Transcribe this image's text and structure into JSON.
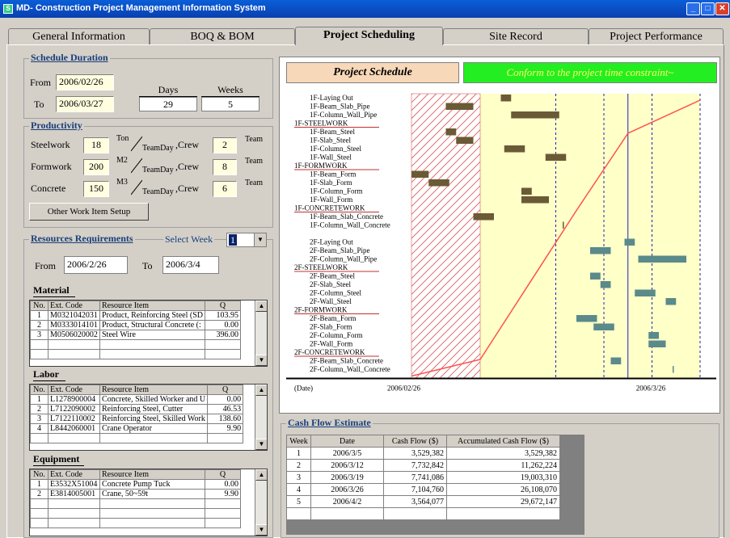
{
  "window": {
    "title": "MD- Construction Project Management Information System"
  },
  "tabs": [
    "General Information",
    "BOQ & BOM",
    "Project Scheduling",
    "Site Record",
    "Project Performance"
  ],
  "schedule_duration": {
    "title": "Schedule Duration",
    "from_label": "From",
    "from_value": "2006/02/26",
    "to_label": "To",
    "to_value": "2006/03/27",
    "days_label": "Days",
    "days_value": "29",
    "weeks_label": "Weeks",
    "weeks_value": "5"
  },
  "productivity": {
    "title": "Productivity",
    "rows": [
      {
        "name": "Steelwork",
        "value": "18",
        "unit": "Ton",
        "crew": "2"
      },
      {
        "name": "Formwork",
        "value": "200",
        "unit": "M2",
        "crew": "8"
      },
      {
        "name": "Concrete",
        "value": "150",
        "unit": "M3",
        "crew": "6"
      }
    ],
    "per_label": "TeamDay",
    "crew_label": ",Crew",
    "team_label": "Team",
    "other_button": "Other Work Item Setup"
  },
  "resources": {
    "title": "Resources Requirements",
    "select_week_label": "Select Week",
    "week_value": "1",
    "from_label": "From",
    "from_value": "2006/2/26",
    "to_label": "To",
    "to_value": "2006/3/4",
    "headers": [
      "No.",
      "Ext. Code",
      "Resource Item",
      "Q"
    ],
    "material_title": "Material",
    "material": [
      [
        "1",
        "M0321042031",
        "Product, Reinforcing Steel (SD",
        "103.95"
      ],
      [
        "2",
        "M0333014101",
        "Product, Structural Concrete (:",
        "0.00"
      ],
      [
        "3",
        "M0506020002",
        "Steel Wire",
        "396.00"
      ]
    ],
    "labor_title": "Labor",
    "labor": [
      [
        "1",
        "L1278900004",
        "Concrete, Skilled Worker and U",
        "0.00"
      ],
      [
        "2",
        "L7122090002",
        "Reinforcing Steel, Cutter",
        "46.53"
      ],
      [
        "3",
        "L7122110002",
        "Reinforcing Steel, Skilled Work",
        "138.60"
      ],
      [
        "4",
        "L8442060001",
        "Crane Operator",
        "9.90"
      ]
    ],
    "equipment_title": "Equipment",
    "equipment": [
      [
        "1",
        "E3532X51004",
        "Concrete Pump Tuck",
        "0.00"
      ],
      [
        "2",
        "E3814005001",
        "Crane, 50~59t",
        "9.90"
      ]
    ]
  },
  "schedule_chart": {
    "title": "Project Schedule",
    "status": "Conform to the project time constraint~",
    "date_label": "(Date)",
    "start_date_label": "2006/02/26",
    "end_date_label": "2006/3/26",
    "tasks": [
      {
        "label": "1F-Laying Out",
        "type": "task",
        "start": 13,
        "dur": 1.5,
        "floor": 1
      },
      {
        "label": "1F-Beam_Slab_Pipe",
        "type": "task",
        "start": 5,
        "dur": 4,
        "floor": 1
      },
      {
        "label": "1F-Column_Wall_Pipe",
        "type": "task",
        "start": 14.5,
        "dur": 7,
        "floor": 1
      },
      {
        "label": "1F-STEELWORK",
        "type": "group"
      },
      {
        "label": "1F-Beam_Steel",
        "type": "task",
        "start": 5,
        "dur": 1.5,
        "floor": 1
      },
      {
        "label": "1F-Slab_Steel",
        "type": "task",
        "start": 6.5,
        "dur": 2.5,
        "floor": 1
      },
      {
        "label": "1F-Column_Steel",
        "type": "task",
        "start": 13.5,
        "dur": 3,
        "floor": 1
      },
      {
        "label": "1F-Wall_Steel",
        "type": "task",
        "start": 19.5,
        "dur": 3,
        "floor": 1
      },
      {
        "label": "1F-FORMWORK",
        "type": "group"
      },
      {
        "label": "1F-Beam_Form",
        "type": "task",
        "start": 0,
        "dur": 2.5,
        "floor": 1
      },
      {
        "label": "1F-Slab_Form",
        "type": "task",
        "start": 2.5,
        "dur": 3,
        "floor": 1
      },
      {
        "label": "1F-Column_Form",
        "type": "task",
        "start": 16,
        "dur": 1.5,
        "floor": 1
      },
      {
        "label": "1F-Wall_Form",
        "type": "task",
        "start": 16,
        "dur": 4,
        "floor": 1
      },
      {
        "label": "1F-CONCRETEWORK",
        "type": "group"
      },
      {
        "label": "1F-Beam_Slab_Concrete",
        "type": "task",
        "start": 9,
        "dur": 3,
        "floor": 1
      },
      {
        "label": "1F-Column_Wall_Concrete",
        "type": "task",
        "start": 22,
        "dur": 0.15,
        "floor": 1
      },
      {
        "label": "",
        "type": "spacer"
      },
      {
        "label": "2F-Laying Out",
        "type": "task",
        "start": 31,
        "dur": 1.5,
        "floor": 2
      },
      {
        "label": "2F-Beam_Slab_Pipe",
        "type": "task",
        "start": 26,
        "dur": 3,
        "floor": 2
      },
      {
        "label": "2F-Column_Wall_Pipe",
        "type": "task",
        "start": 33,
        "dur": 7,
        "floor": 2
      },
      {
        "label": "2F-STEELWORK",
        "type": "group"
      },
      {
        "label": "2F-Beam_Steel",
        "type": "task",
        "start": 26,
        "dur": 1.5,
        "floor": 2
      },
      {
        "label": "2F-Slab_Steel",
        "type": "task",
        "start": 27.5,
        "dur": 1.5,
        "floor": 2
      },
      {
        "label": "2F-Column_Steel",
        "type": "task",
        "start": 32.5,
        "dur": 3,
        "floor": 2
      },
      {
        "label": "2F-Wall_Steel",
        "type": "task",
        "start": 37,
        "dur": 1.5,
        "floor": 2
      },
      {
        "label": "2F-FORMWORK",
        "type": "group"
      },
      {
        "label": "2F-Beam_Form",
        "type": "task",
        "start": 24,
        "dur": 3,
        "floor": 2
      },
      {
        "label": "2F-Slab_Form",
        "type": "task",
        "start": 26.5,
        "dur": 3,
        "floor": 2
      },
      {
        "label": "2F-Column_Form",
        "type": "task",
        "start": 34.5,
        "dur": 1.5,
        "floor": 2
      },
      {
        "label": "2F-Wall_Form",
        "type": "task",
        "start": 34.5,
        "dur": 2.5,
        "floor": 2
      },
      {
        "label": "2F-CONCRETEWORK",
        "type": "group"
      },
      {
        "label": "2F-Beam_Slab_Concrete",
        "type": "task",
        "start": 29,
        "dur": 1.5,
        "floor": 2
      },
      {
        "label": "2F-Column_Wall_Concrete",
        "type": "task",
        "start": 38,
        "dur": 0.15,
        "floor": 2
      }
    ],
    "colors": {
      "floor1": "#6a5a35",
      "floor2": "#5a8a8a",
      "curve": "#ff5050",
      "bg": "#ffffc8",
      "hatch": "#d04040",
      "line": "#2020c0"
    }
  },
  "cash_flow": {
    "title": "Cash Flow Estimate",
    "headers": [
      "Week",
      "Date",
      "Cash Flow ($)",
      "Accumulated Cash Flow ($)"
    ],
    "rows": [
      [
        "1",
        "2006/3/5",
        "3,529,382",
        "3,529,382"
      ],
      [
        "2",
        "2006/3/12",
        "7,732,842",
        "11,262,224"
      ],
      [
        "3",
        "2006/3/19",
        "7,741,086",
        "19,003,310"
      ],
      [
        "4",
        "2006/3/26",
        "7,104,760",
        "26,108,070"
      ],
      [
        "5",
        "2006/4/2",
        "3,564,077",
        "29,672,147"
      ]
    ]
  }
}
